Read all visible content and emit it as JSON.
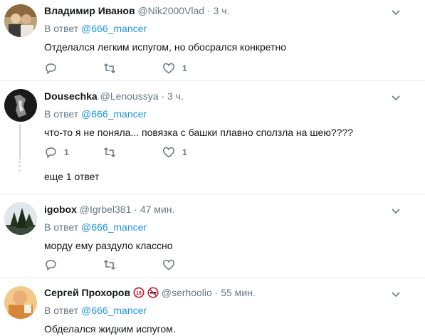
{
  "replies": [
    {
      "name": "Владимир Иванов",
      "handle": "@Nik2000Vlad",
      "separator": "·",
      "time": "3 ч.",
      "reply_prefix": "В ответ",
      "reply_mention": "@666_mancer",
      "text": "Отделался легким испугом, но обосрался конкретно",
      "reply_count": "",
      "retweet_count": "",
      "like_count": "1"
    },
    {
      "name": "Dousechka",
      "handle": "@Lenoussya",
      "separator": "·",
      "time": "3 ч.",
      "reply_prefix": "В ответ",
      "reply_mention": "@666_mancer",
      "text": "что-то я не поняла... повязка с башки плавно сползла на шею????",
      "reply_count": "1",
      "retweet_count": "",
      "like_count": "1",
      "more_replies": "еще 1 ответ"
    },
    {
      "name": "igobox",
      "handle": "@Igrbel381",
      "separator": "·",
      "time": "47 мин.",
      "reply_prefix": "В ответ",
      "reply_mention": "@666_mancer",
      "text": "морду ему раздуло классно",
      "reply_count": "",
      "retweet_count": "",
      "like_count": ""
    },
    {
      "name": "Сергей Прохоров",
      "handle": "@serhoolio",
      "separator": "·",
      "time": "55 мин.",
      "reply_prefix": "В ответ",
      "reply_mention": "@666_mancer",
      "text": "Обделался жидким испугом.",
      "badges": [
        "18-plus-icon",
        "no-smoking-icon"
      ]
    }
  ],
  "colors": {
    "text": "#14171a",
    "secondary": "#657786",
    "link": "#1b95e0",
    "divider": "#e6ecf0"
  },
  "icons": [
    "reply-icon",
    "retweet-icon",
    "like-icon",
    "caret-down-icon"
  ]
}
